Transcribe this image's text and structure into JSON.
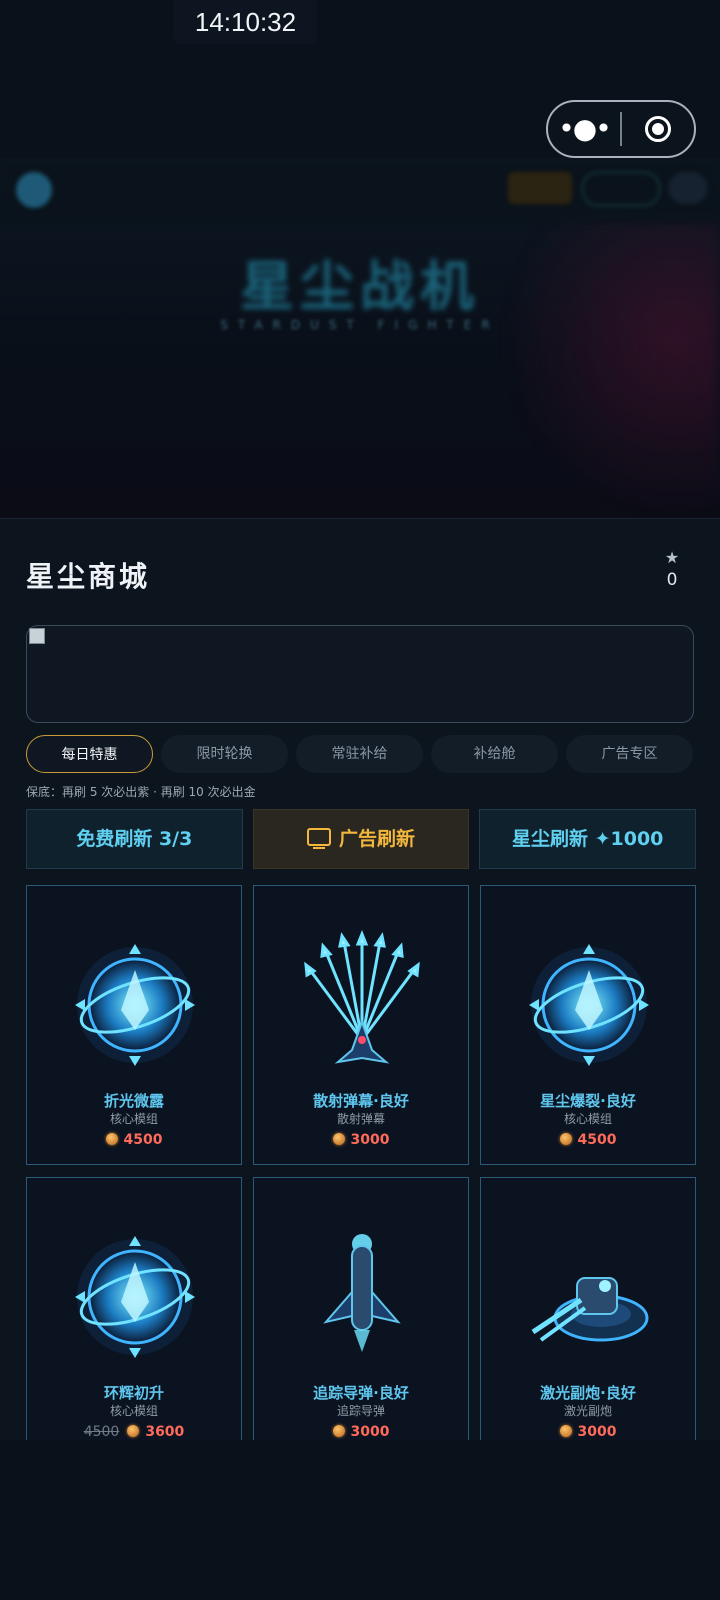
{
  "status_bar": {
    "time": "14:10:32"
  },
  "miniprogram_capsule": {
    "more_icon": "more-dots-icon",
    "close_icon": "target-icon"
  },
  "background_game": {
    "title": "星尘战机",
    "subtitle": "STARDUST FIGHTER"
  },
  "shop": {
    "title": "星尘商城",
    "star_count": "0",
    "star_icon": "★",
    "tabs": [
      {
        "label": "每日特惠",
        "active": true
      },
      {
        "label": "限时轮换",
        "active": false
      },
      {
        "label": "常驻补给",
        "active": false
      },
      {
        "label": "补给舱",
        "active": false
      },
      {
        "label": "广告专区",
        "active": false
      }
    ],
    "guarantee_text": "保底：再刷 5 次必出紫 · 再刷 10 次必出金",
    "refresh": {
      "free_label": "免费刷新 3/3",
      "ad_label": "广告刷新",
      "stardust_label": "星尘刷新 ",
      "stardust_cost": "1000"
    },
    "items": [
      {
        "name": "折光微露",
        "type": "核心模组",
        "price": "4500",
        "old_price": "",
        "icon": "core-module-icon"
      },
      {
        "name": "散射弹幕·良好",
        "type": "散射弹幕",
        "price": "3000",
        "old_price": "",
        "icon": "spread-shot-icon"
      },
      {
        "name": "星尘爆裂·良好",
        "type": "核心模组",
        "price": "4500",
        "old_price": "",
        "icon": "core-module-icon"
      },
      {
        "name": "环辉初升",
        "type": "核心模组",
        "price": "3600",
        "old_price": "4500",
        "icon": "core-module-icon"
      },
      {
        "name": "追踪导弹·良好",
        "type": "追踪导弹",
        "price": "3000",
        "old_price": "",
        "icon": "homing-missile-icon"
      },
      {
        "name": "激光副炮·良好",
        "type": "激光副炮",
        "price": "3000",
        "old_price": "",
        "icon": "laser-turret-icon"
      }
    ]
  },
  "colors": {
    "accent_cyan": "#5fd0ef",
    "accent_gold": "#f2b73c",
    "price_red": "#ff6a5a"
  }
}
